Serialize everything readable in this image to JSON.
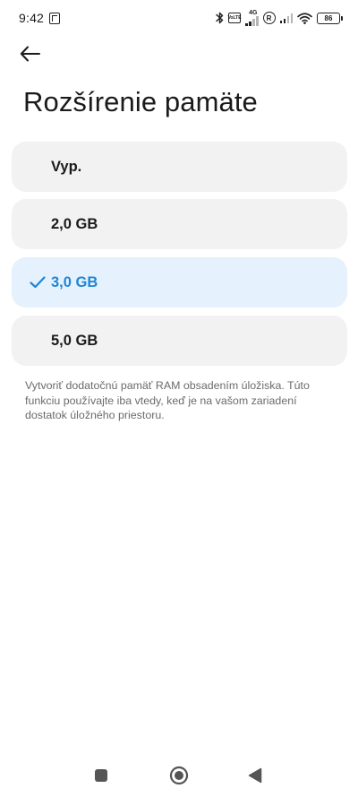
{
  "status_bar": {
    "time": "9:42",
    "lte_badge": "4G",
    "volte_label": "VoLTE",
    "roaming_label": "R",
    "battery_level": "86"
  },
  "header": {
    "title": "Rozšírenie pamäte"
  },
  "options": [
    {
      "label": "Vyp.",
      "selected": false
    },
    {
      "label": "2,0 GB",
      "selected": false
    },
    {
      "label": "3,0 GB",
      "selected": true
    },
    {
      "label": "5,0 GB",
      "selected": false
    }
  ],
  "description": "Vytvoriť dodatočnú pamäť RAM obsadením úložiska. Túto funkciu používajte iba vtedy, keď je na vašom zariadení dostatok úložného priestoru.",
  "colors": {
    "accent": "#1e86d6",
    "selected_bg": "#e5f1fc",
    "option_bg": "#f2f2f2",
    "description_text": "#6b6b6b"
  },
  "icons": {
    "back": "arrow-left-icon",
    "selected_marker": "check-icon",
    "nav_recent": "square-icon",
    "nav_home": "circle-icon",
    "nav_back": "triangle-back-icon"
  }
}
